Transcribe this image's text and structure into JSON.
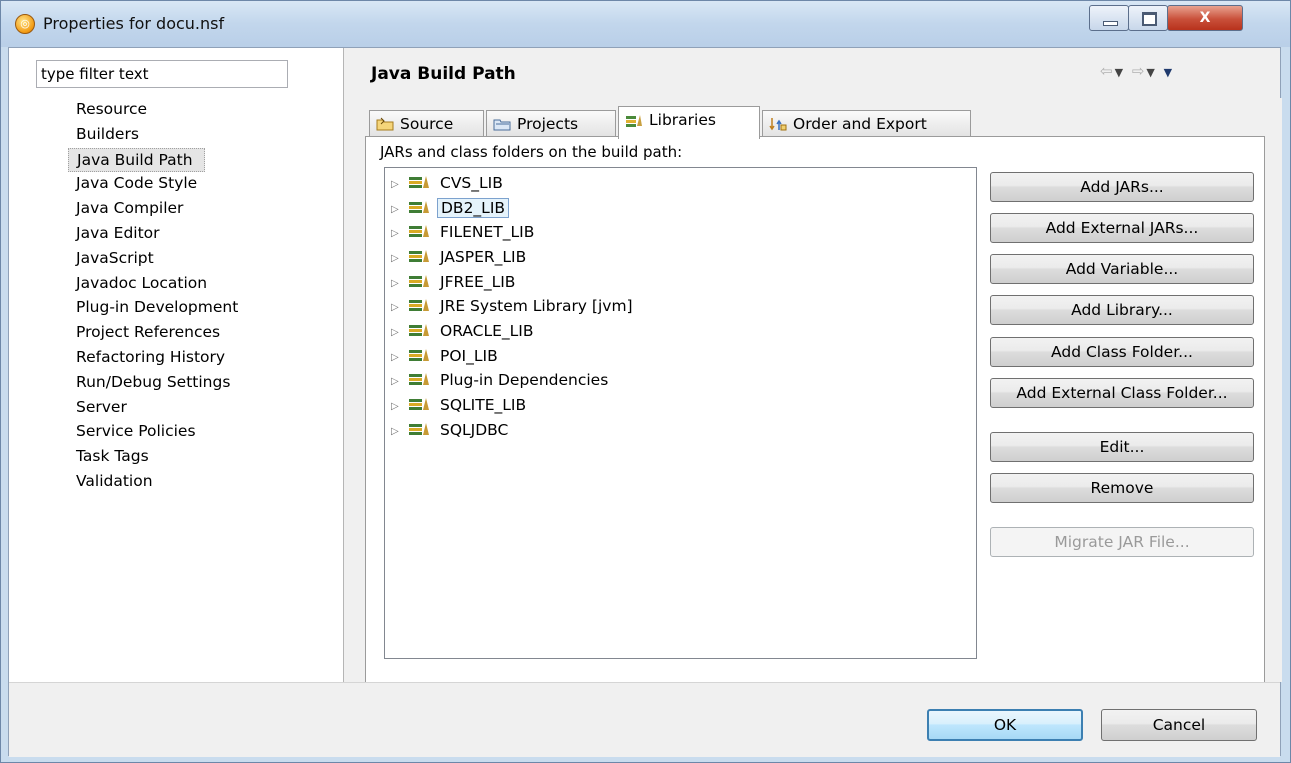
{
  "window": {
    "title": "Properties for docu.nsf",
    "close_glyph": "X"
  },
  "filter": {
    "value": "type filter text"
  },
  "nav": {
    "items": [
      {
        "label": "Resource"
      },
      {
        "label": "Builders"
      },
      {
        "label": "Java Build Path",
        "selected": true
      },
      {
        "label": "Java Code Style"
      },
      {
        "label": "Java Compiler"
      },
      {
        "label": "Java Editor"
      },
      {
        "label": "JavaScript"
      },
      {
        "label": "Javadoc Location"
      },
      {
        "label": "Plug-in Development"
      },
      {
        "label": "Project References"
      },
      {
        "label": "Refactoring History"
      },
      {
        "label": "Run/Debug Settings"
      },
      {
        "label": "Server"
      },
      {
        "label": "Service Policies"
      },
      {
        "label": "Task Tags"
      },
      {
        "label": "Validation"
      }
    ]
  },
  "page": {
    "title": "Java Build Path"
  },
  "tabs": [
    {
      "label": "Source",
      "icon": "source-folder-icon"
    },
    {
      "label": "Projects",
      "icon": "projects-folder-icon"
    },
    {
      "label": "Libraries",
      "icon": "library-icon",
      "active": true
    },
    {
      "label": "Order and Export",
      "icon": "order-export-icon"
    }
  ],
  "libraries": {
    "label": "JARs and class folders on the build path:",
    "items": [
      {
        "label": "CVS_LIB"
      },
      {
        "label": "DB2_LIB",
        "selected": true
      },
      {
        "label": "FILENET_LIB"
      },
      {
        "label": "JASPER_LIB"
      },
      {
        "label": "JFREE_LIB"
      },
      {
        "label": "JRE System Library [jvm]"
      },
      {
        "label": "ORACLE_LIB"
      },
      {
        "label": "POI_LIB"
      },
      {
        "label": "Plug-in Dependencies"
      },
      {
        "label": "SQLITE_LIB"
      },
      {
        "label": "SQLJDBC"
      }
    ],
    "buttons": {
      "add_jars": "Add JARs...",
      "add_external_jars": "Add External JARs...",
      "add_variable": "Add Variable...",
      "add_library": "Add Library...",
      "add_class_folder": "Add Class Folder...",
      "add_external_class_folder": "Add External Class Folder...",
      "edit": "Edit...",
      "remove": "Remove",
      "migrate_jar": "Migrate JAR File..."
    }
  },
  "footer": {
    "ok": "OK",
    "cancel": "Cancel"
  },
  "colors": {
    "selection": "#e5f3fb",
    "selection_border": "#7da2ce",
    "default_button_border": "#3c7fb1",
    "close_button": "#c9503a"
  }
}
